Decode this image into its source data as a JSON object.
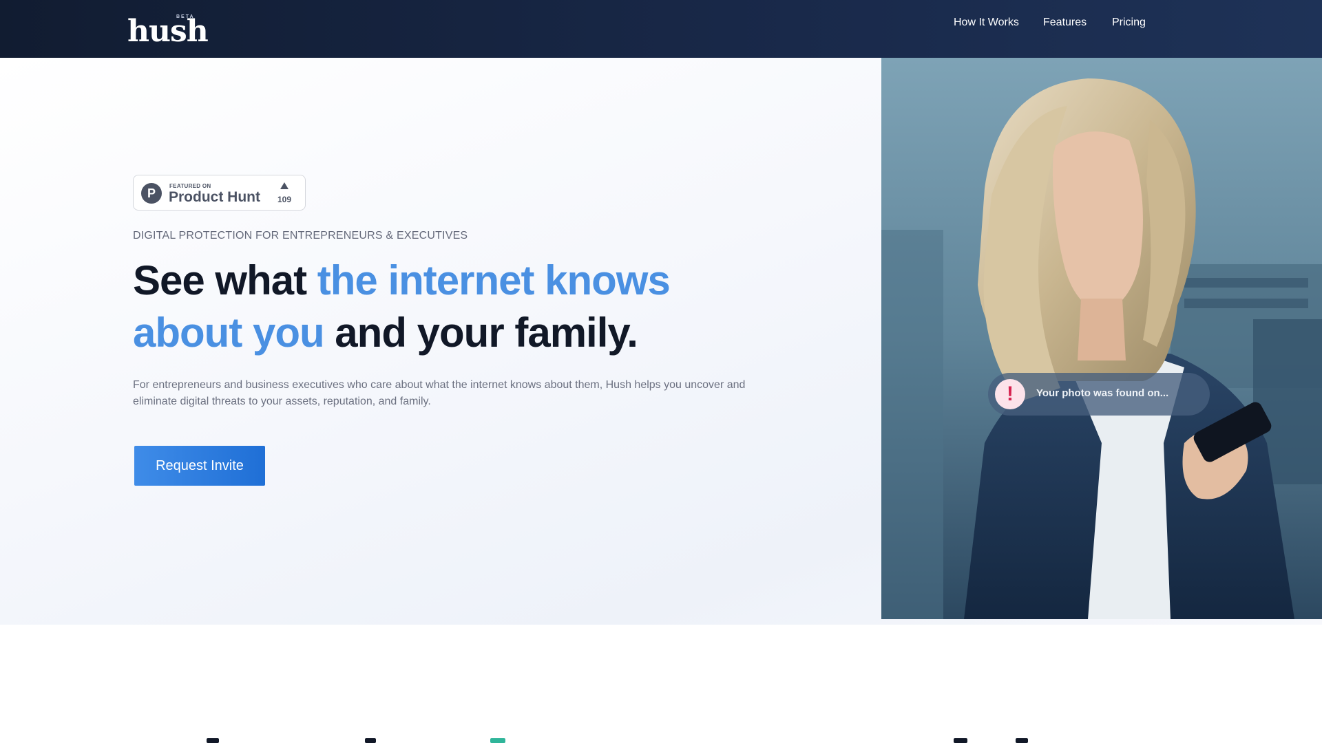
{
  "header": {
    "logo_text": "hush",
    "logo_badge": "BETA",
    "nav": [
      {
        "label": "How It Works"
      },
      {
        "label": "Features"
      },
      {
        "label": "Pricing"
      }
    ]
  },
  "hero": {
    "product_hunt": {
      "featured_on": "FEATURED ON",
      "name": "Product Hunt",
      "logo_letter": "P",
      "votes": "109"
    },
    "eyebrow": "DIGITAL PROTECTION FOR ENTREPRENEURS & EXECUTIVES",
    "headline": {
      "part1": "See what ",
      "accent": "the internet knows about you",
      "part2": " and your family."
    },
    "subtext": "For entrepreneurs and business executives who care about what the internet knows about them, Hush helps you uncover and eliminate digital threats to your assets, reputation, and family.",
    "cta_label": "Request Invite"
  },
  "photo_card": {
    "toast_icon": "!",
    "toast_text": "Your photo was found on..."
  },
  "colors": {
    "header_bg": "#111c31",
    "accent_blue": "#4a90e2",
    "cta_blue": "#1f6fd6",
    "headline_dark": "#111827",
    "alert_red": "#d6224f"
  },
  "icons": [
    "product-hunt-logo",
    "upvote-arrow-icon",
    "alert-exclamation-icon"
  ]
}
